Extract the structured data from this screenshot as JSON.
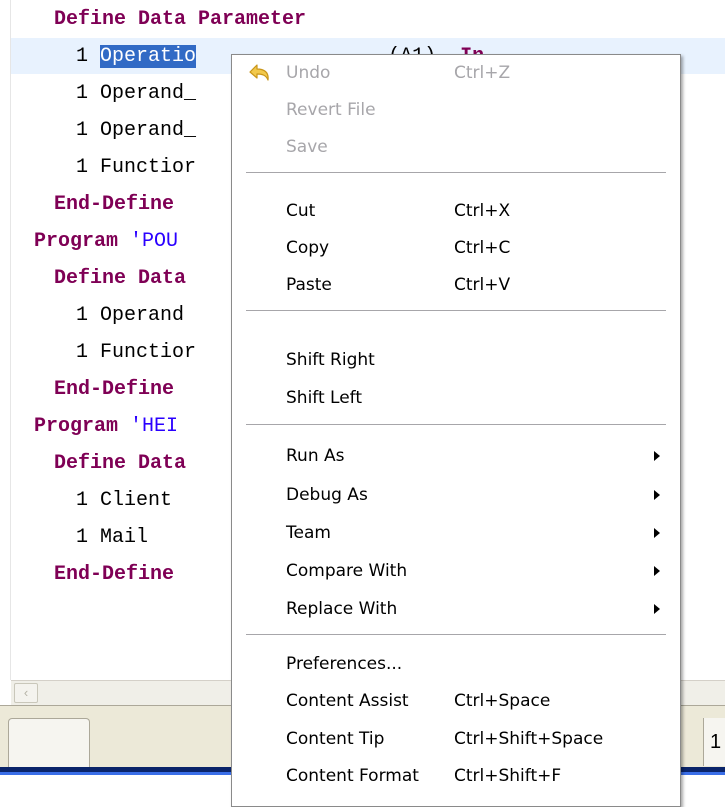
{
  "editor": {
    "lines": [
      {
        "k1": "Define Data Parameter"
      },
      {
        "n": "1 ",
        "sel": "Operatio",
        "rest": "                ",
        "rest2": "(A1)  ",
        "kw": "In"
      },
      {
        "n": "1 Operand_"
      },
      {
        "n": "1 Operand_"
      },
      {
        "n": "1 Functior"
      },
      {
        "k1": "End-Define"
      },
      {
        "k1": "Program ",
        "s": "'POU"
      },
      {
        "k1": "Define Data"
      },
      {
        "n": "1 Operand"
      },
      {
        "n": "1 Functior"
      },
      {
        "k1": "End-Define"
      },
      {
        "k1": "Program ",
        "s": "'HEI"
      },
      {
        "k1": "Define Data"
      },
      {
        "n": "1 Client"
      },
      {
        "n": "1 Mail"
      },
      {
        "k1": "End-Define"
      }
    ]
  },
  "scrollbar": {
    "left_arrow": "‹"
  },
  "statusbar": {
    "right_tab_text": "1"
  },
  "context_menu": {
    "items": [
      {
        "label": "Undo",
        "shortcut": "Ctrl+Z",
        "disabled": true,
        "icon": "undo-arrow-icon"
      },
      {
        "label": "Revert File",
        "disabled": true
      },
      {
        "label": "Save",
        "disabled": true
      },
      {
        "label": "Cut",
        "shortcut": "Ctrl+X"
      },
      {
        "label": "Copy",
        "shortcut": "Ctrl+C"
      },
      {
        "label": "Paste",
        "shortcut": "Ctrl+V"
      },
      {
        "label": "Shift Right"
      },
      {
        "label": "Shift Left"
      },
      {
        "label": "Run As",
        "submenu": true
      },
      {
        "label": "Debug As",
        "submenu": true
      },
      {
        "label": "Team",
        "submenu": true
      },
      {
        "label": "Compare With",
        "submenu": true
      },
      {
        "label": "Replace With",
        "submenu": true
      },
      {
        "label": "Preferences..."
      },
      {
        "label": "Content Assist",
        "shortcut": "Ctrl+Space"
      },
      {
        "label": "Content Tip",
        "shortcut": "Ctrl+Shift+Space"
      },
      {
        "label": "Content Format",
        "shortcut": "Ctrl+Shift+F"
      }
    ]
  },
  "colors": {
    "keyword": "#7f0055",
    "string": "#2a00ff",
    "selection": "#316ac5",
    "disabled_text": "#a7a6aa"
  }
}
